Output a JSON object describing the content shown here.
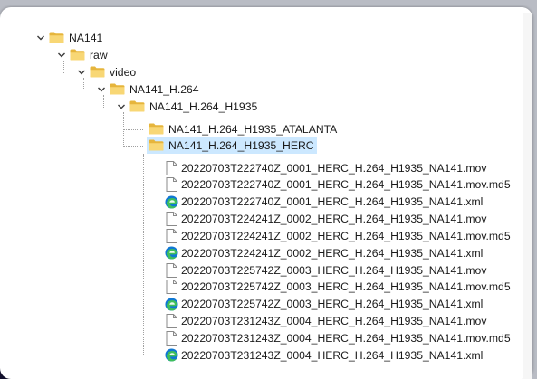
{
  "tree": {
    "folders": [
      {
        "label": "NA141",
        "expanded": true
      },
      {
        "label": "raw",
        "expanded": true
      },
      {
        "label": "video",
        "expanded": true
      },
      {
        "label": "NA141_H.264",
        "expanded": true
      },
      {
        "label": "NA141_H.264_H1935",
        "expanded": true
      },
      {
        "label": "NA141_H.264_H1935_ATALANTA",
        "expanded": false
      },
      {
        "label": "NA141_H.264_H1935_HERC",
        "expanded": false,
        "selected": true
      }
    ],
    "files": [
      {
        "name": "20220703T222740Z_0001_HERC_H.264_H1935_NA141.mov",
        "icon": "file-icon"
      },
      {
        "name": "20220703T222740Z_0001_HERC_H.264_H1935_NA141.mov.md5",
        "icon": "file-icon"
      },
      {
        "name": "20220703T222740Z_0001_HERC_H.264_H1935_NA141.xml",
        "icon": "edge-icon"
      },
      {
        "name": "20220703T224241Z_0002_HERC_H.264_H1935_NA141.mov",
        "icon": "file-icon"
      },
      {
        "name": "20220703T224241Z_0002_HERC_H.264_H1935_NA141.mov.md5",
        "icon": "file-icon"
      },
      {
        "name": "20220703T224241Z_0002_HERC_H.264_H1935_NA141.xml",
        "icon": "edge-icon"
      },
      {
        "name": "20220703T225742Z_0003_HERC_H.264_H1935_NA141.mov",
        "icon": "file-icon"
      },
      {
        "name": "20220703T225742Z_0003_HERC_H.264_H1935_NA141.mov.md5",
        "icon": "file-icon"
      },
      {
        "name": "20220703T225742Z_0003_HERC_H.264_H1935_NA141.xml",
        "icon": "edge-icon"
      },
      {
        "name": "20220703T231243Z_0004_HERC_H.264_H1935_NA141.mov",
        "icon": "file-icon"
      },
      {
        "name": "20220703T231243Z_0004_HERC_H.264_H1935_NA141.mov.md5",
        "icon": "file-icon"
      },
      {
        "name": "20220703T231243Z_0004_HERC_H.264_H1935_NA141.xml",
        "icon": "edge-icon"
      }
    ]
  },
  "colors": {
    "selection": "#cce8ff",
    "folder": "#f8d775",
    "folder_dark": "#e6b53c",
    "edge_blue": "#0f78d4",
    "edge_green": "#3fbf5a"
  }
}
